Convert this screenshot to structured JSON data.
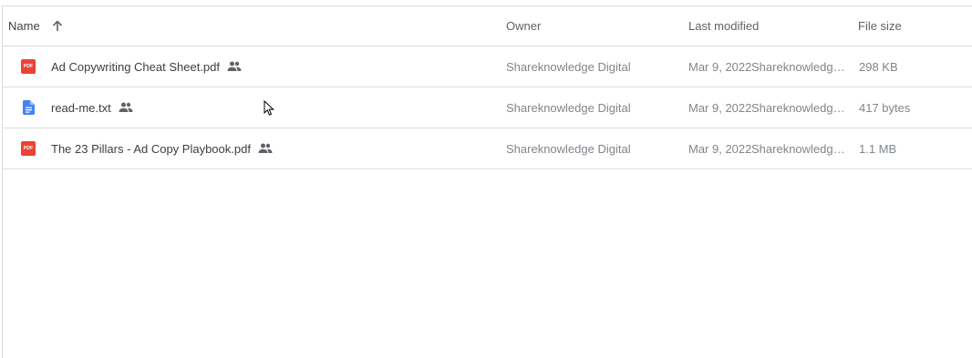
{
  "columns": {
    "name": "Name",
    "owner": "Owner",
    "last_modified": "Last modified",
    "file_size": "File size"
  },
  "rows": [
    {
      "name": "Ad Copywriting Cheat Sheet.pdf",
      "icon": "pdf-icon",
      "icon_label": "PDF",
      "owner": "Shareknowledge Digital",
      "modified_date": "Mar 9, 2022",
      "modified_by": "Shareknowledge Digital",
      "size": "298 KB"
    },
    {
      "name": "read-me.txt",
      "icon": "text-document-icon",
      "icon_label": "",
      "owner": "Shareknowledge Digital",
      "modified_date": "Mar 9, 2022",
      "modified_by": "Shareknowledge Digital",
      "size": "417 bytes"
    },
    {
      "name": "The 23 Pillars - Ad Copy Playbook.pdf",
      "icon": "pdf-icon",
      "icon_label": "PDF",
      "owner": "Shareknowledge Digital",
      "modified_date": "Mar 9, 2022",
      "modified_by": "Shareknowledge Digital",
      "size": "1.1 MB"
    }
  ],
  "colors": {
    "pdf": "#ea4335",
    "doc": "#4285f4",
    "divider": "#dadce0"
  }
}
